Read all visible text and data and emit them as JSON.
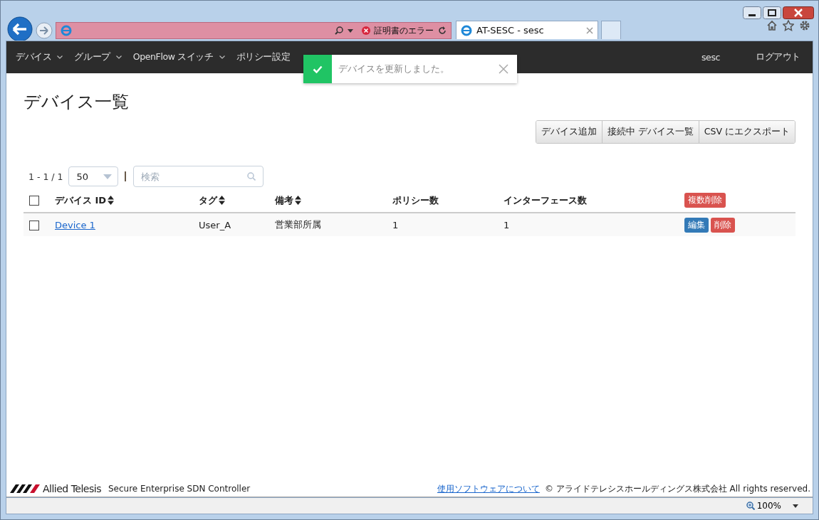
{
  "browser": {
    "security_warning": "証明書のエラー",
    "tabs": [
      {
        "title": "AT-SESC - sesc",
        "selected": true
      }
    ],
    "zoom": "100%"
  },
  "nav": {
    "items": [
      {
        "label": "デバイス",
        "dropdown": true
      },
      {
        "label": "グループ",
        "dropdown": true
      },
      {
        "label": "OpenFlow スイッチ",
        "dropdown": true
      },
      {
        "label": "ポリシー設定",
        "dropdown": false
      }
    ],
    "user": "sesc",
    "logout": "ログアウト"
  },
  "toast": {
    "message": "デバイスを更新しました。"
  },
  "page_title": "デバイス一覧",
  "actions": [
    "デバイス追加",
    "接続中 デバイス一覧",
    "CSV にエクスポート"
  ],
  "pager": {
    "range": "1 - 1 / 1",
    "per_page": "50",
    "search_placeholder": "検索"
  },
  "table": {
    "select_all_checked": false,
    "columns": [
      {
        "label": "デバイス ID",
        "sortable": true
      },
      {
        "label": "タグ",
        "sortable": true
      },
      {
        "label": "備考",
        "sortable": true
      },
      {
        "label": "ポリシー数",
        "sortable": false
      },
      {
        "label": "インターフェース数",
        "sortable": false
      }
    ],
    "bulk_delete": "複数削除",
    "rows": [
      {
        "checked": false,
        "cells": [
          "Device 1",
          "User_A",
          "営業部所属",
          "1",
          "1"
        ],
        "edit": "編集",
        "delete": "削除"
      }
    ]
  },
  "footer": {
    "brand": "Allied Telesis",
    "product": "Secure Enterprise SDN Controller",
    "link": "使用ソフトウェアについて",
    "copyright": "© アライドテレシスホールディングス株式会社 All rights reserved."
  }
}
